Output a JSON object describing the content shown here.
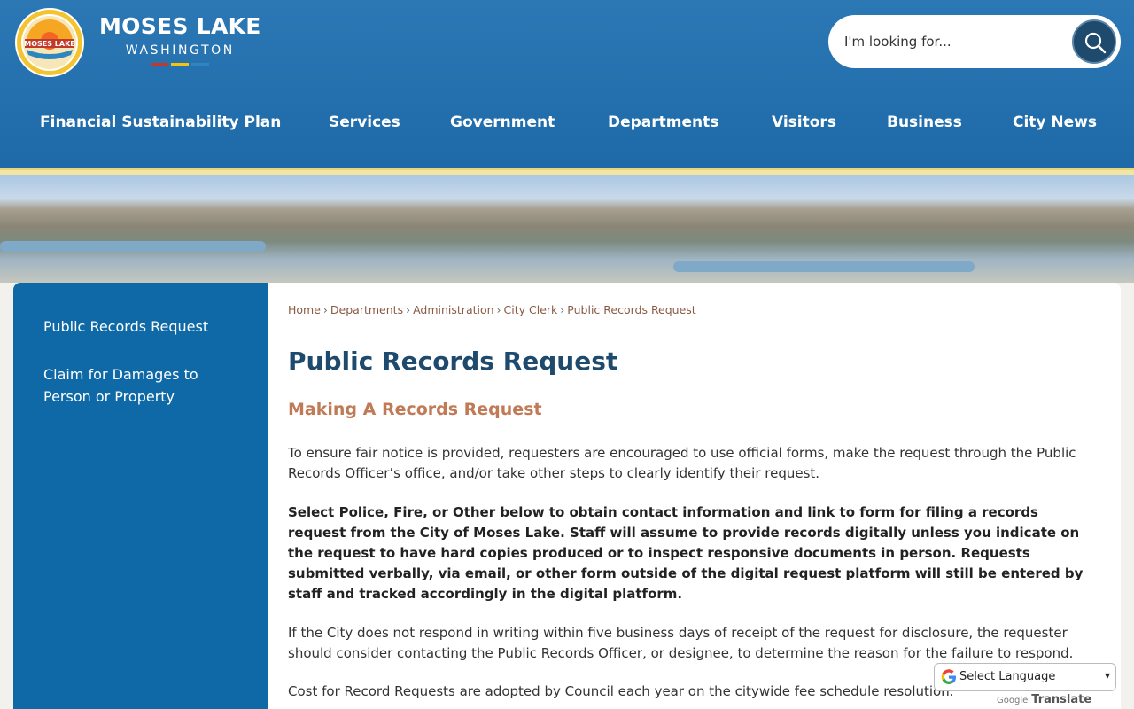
{
  "brand": {
    "title": "MOSES LAKE",
    "subtitle": "WASHINGTON",
    "logo_text": "MOSES LAKE",
    "bar_colors": [
      "#c0392b",
      "#f1c40f",
      "#2e86c1"
    ]
  },
  "search": {
    "placeholder": "I'm looking for..."
  },
  "nav": [
    "Financial Sustainability Plan",
    "Services",
    "Government",
    "Departments",
    "Visitors",
    "Business",
    "City News"
  ],
  "sidebar": [
    "Public Records Request",
    "Claim for Damages to Person or Property"
  ],
  "breadcrumb": [
    "Home",
    "Departments",
    "Administration",
    "City Clerk",
    "Public Records Request"
  ],
  "page": {
    "title": "Public Records Request",
    "subtitle": "Making A Records Request",
    "p1": "To ensure fair notice is provided, requesters are encouraged to use official forms, make the request through the Public Records Officer’s office, and/or take other steps to clearly identify their request.",
    "p2": "Select Police, Fire, or Other below to obtain contact information and link to form for filing a records request from the City of Moses Lake. Staff will assume to provide records digitally unless you indicate on the request to have hard copies produced or to inspect responsive documents in person. Requests submitted verbally, via email, or other form outside of the digital request platform will still be entered by staff and tracked accordingly in the digital platform.",
    "p3": "If the City does not respond in writing within five business days of receipt of the request for disclosure, the requester should consider contacting the Public Records Officer, or designee, to determine the reason for the failure to respond.",
    "p4": "Cost for Record Requests are adopted by Council each year on the citywide fee schedule resolution."
  },
  "translate": {
    "label": "Select Language",
    "powered_by": "Google",
    "service": "Translate"
  },
  "colors": {
    "header": "#1e6aa8",
    "sidebar": "#0e69a6",
    "title": "#1e4a6e",
    "accent": "#c07a55"
  }
}
